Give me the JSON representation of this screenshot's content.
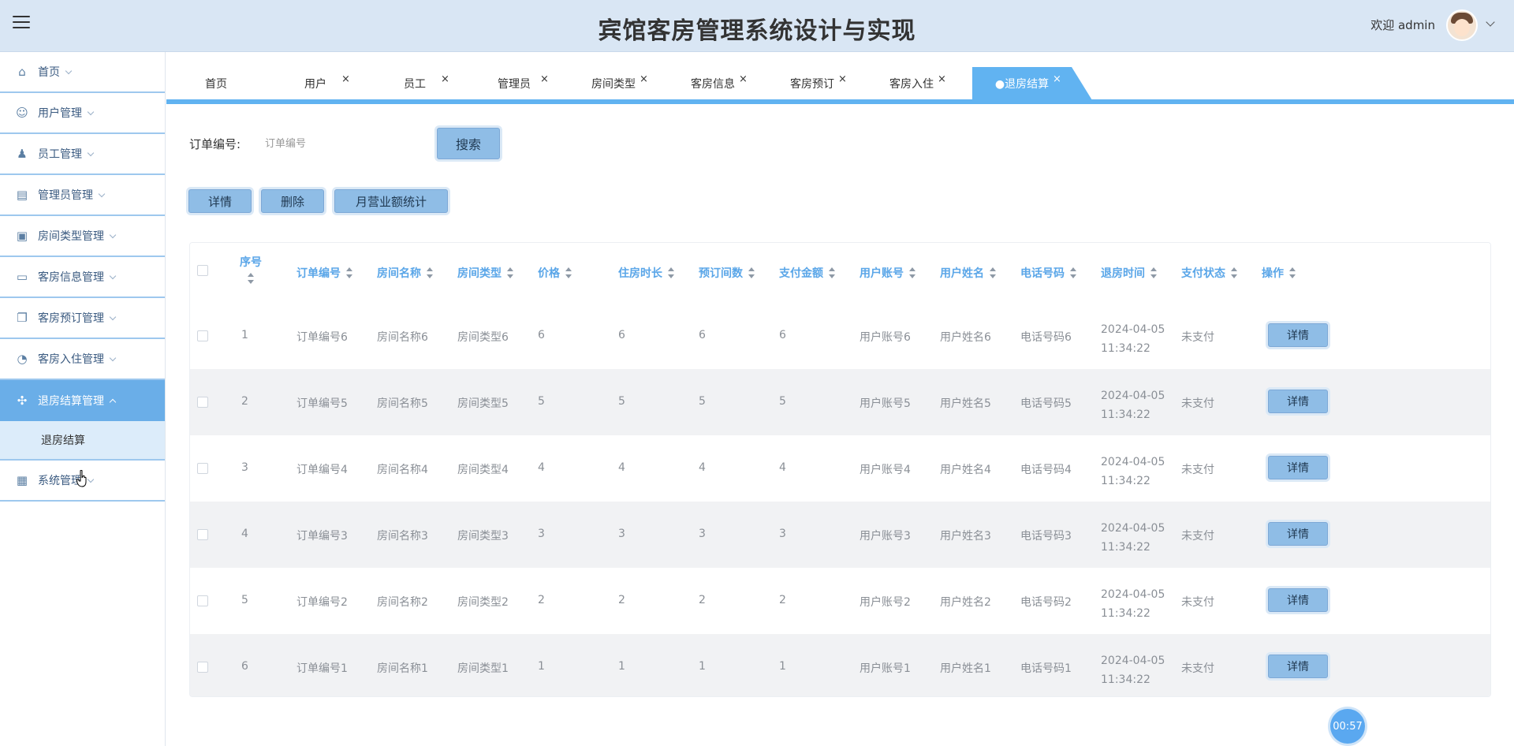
{
  "header": {
    "title": "宾馆客房管理系统设计与实现",
    "welcome": "欢迎 admin"
  },
  "sidebar": {
    "items": [
      {
        "label": "首页",
        "icon": "home-icon"
      },
      {
        "label": "用户管理",
        "icon": "user-icon"
      },
      {
        "label": "员工管理",
        "icon": "person-icon"
      },
      {
        "label": "管理员管理",
        "icon": "store-icon"
      },
      {
        "label": "房间类型管理",
        "icon": "briefcase-icon"
      },
      {
        "label": "客房信息管理",
        "icon": "box-icon"
      },
      {
        "label": "客房预订管理",
        "icon": "copy-icon"
      },
      {
        "label": "客房入住管理",
        "icon": "pie-icon"
      },
      {
        "label": "退房结算管理",
        "icon": "grid-icon"
      },
      {
        "label": "系统管理",
        "icon": "windows-icon"
      }
    ],
    "sub_item": "退房结算"
  },
  "tabs": [
    {
      "label": "首页",
      "closable": false
    },
    {
      "label": "用户",
      "closable": true
    },
    {
      "label": "员工",
      "closable": true
    },
    {
      "label": "管理员",
      "closable": true
    },
    {
      "label": "房间类型",
      "closable": true
    },
    {
      "label": "客房信息",
      "closable": true
    },
    {
      "label": "客房预订",
      "closable": true
    },
    {
      "label": "客房入住",
      "closable": true
    },
    {
      "label": "●退房结算",
      "closable": true
    }
  ],
  "tab_close_glyph": "×",
  "search": {
    "label": "订单编号:",
    "placeholder": "订单编号",
    "button": "搜索"
  },
  "actions": {
    "detail": "详情",
    "delete": "删除",
    "monthly": "月营业额统计"
  },
  "table": {
    "headers": [
      "序号",
      "订单编号",
      "房间名称",
      "房间类型",
      "价格",
      "住房时长",
      "预订间数",
      "支付金额",
      "用户账号",
      "用户姓名",
      "电话号码",
      "退房时间",
      "支付状态",
      "操作"
    ],
    "row_button": "详情",
    "rows": [
      [
        "1",
        "订单编号6",
        "房间名称6",
        "房间类型6",
        "6",
        "6",
        "6",
        "6",
        "用户账号6",
        "用户姓名6",
        "电话号码6",
        "2024-04-05 11:34:22",
        "未支付"
      ],
      [
        "2",
        "订单编号5",
        "房间名称5",
        "房间类型5",
        "5",
        "5",
        "5",
        "5",
        "用户账号5",
        "用户姓名5",
        "电话号码5",
        "2024-04-05 11:34:22",
        "未支付"
      ],
      [
        "3",
        "订单编号4",
        "房间名称4",
        "房间类型4",
        "4",
        "4",
        "4",
        "4",
        "用户账号4",
        "用户姓名4",
        "电话号码4",
        "2024-04-05 11:34:22",
        "未支付"
      ],
      [
        "4",
        "订单编号3",
        "房间名称3",
        "房间类型3",
        "3",
        "3",
        "3",
        "3",
        "用户账号3",
        "用户姓名3",
        "电话号码3",
        "2024-04-05 11:34:22",
        "未支付"
      ],
      [
        "5",
        "订单编号2",
        "房间名称2",
        "房间类型2",
        "2",
        "2",
        "2",
        "2",
        "用户账号2",
        "用户姓名2",
        "电话号码2",
        "2024-04-05 11:34:22",
        "未支付"
      ],
      [
        "6",
        "订单编号1",
        "房间名称1",
        "房间类型1",
        "1",
        "1",
        "1",
        "1",
        "用户账号1",
        "用户姓名1",
        "电话号码1",
        "2024-04-05 11:34:22",
        "未支付"
      ]
    ]
  },
  "timer": "00:57",
  "colors": {
    "accent": "#61b3f1",
    "header_bg": "#d9e6f4",
    "header_text": "#5aa6e8"
  }
}
